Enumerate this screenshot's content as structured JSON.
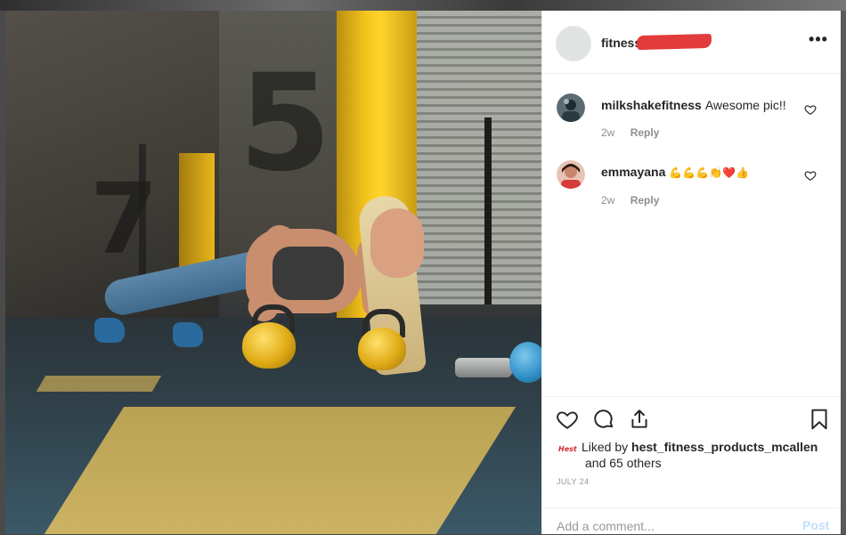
{
  "post": {
    "author": "fitness",
    "more_label": "•••"
  },
  "comments": [
    {
      "user": "milkshakefitness",
      "text": "Awesome pic!!",
      "age": "2w",
      "reply_label": "Reply"
    },
    {
      "user": "emmayana",
      "text": "💪💪💪👏❤️👍",
      "age": "2w",
      "reply_label": "Reply"
    }
  ],
  "photo": {
    "stencil_numbers": [
      "5",
      "7"
    ]
  },
  "likes": {
    "prefix": "Liked by",
    "liker": "hest_fitness_products_mcallen",
    "and": "and",
    "others": "65 others",
    "liker_avatar_text": "Hest"
  },
  "date": "JULY 24",
  "add_comment": {
    "placeholder": "Add a comment...",
    "post_label": "Post"
  },
  "colors": {
    "text": "#262626",
    "muted": "#8e8e8e",
    "post_disabled": "#c4dffb",
    "redaction": "#e23b3b"
  },
  "icons": [
    "heart-icon",
    "comment-icon",
    "share-icon",
    "bookmark-icon",
    "more-options-icon",
    "like-comment-heart-icon"
  ]
}
